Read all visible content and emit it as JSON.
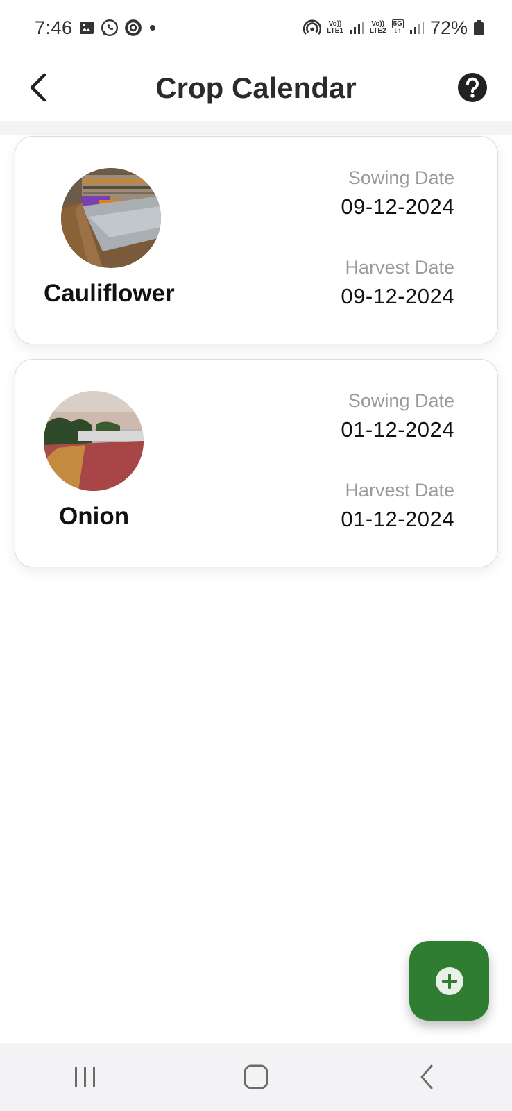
{
  "status_bar": {
    "time": "7:46",
    "battery": "72%",
    "sim1": "LTE1",
    "sim2": "LTE2",
    "network": "5G",
    "icons": [
      "gallery-icon",
      "whatsapp-icon",
      "chat-icon",
      "dot-icon",
      "hotspot-icon",
      "signal-icon",
      "battery-icon"
    ]
  },
  "app_bar": {
    "title": "Crop Calendar",
    "back_icon": "chevron-left-icon",
    "help_icon": "help-circle-icon"
  },
  "crops": [
    {
      "name": "Cauliflower",
      "sowing_label": "Sowing Date",
      "sowing_date": "09-12-2024",
      "harvest_label": "Harvest Date",
      "harvest_date": "09-12-2024"
    },
    {
      "name": "Onion",
      "sowing_label": "Sowing Date",
      "sowing_date": "01-12-2024",
      "harvest_label": "Harvest Date",
      "harvest_date": "01-12-2024"
    }
  ],
  "fab": {
    "icon": "plus-circle-icon"
  },
  "colors": {
    "accent": "#2e7d32",
    "label_gray": "#9a9a9a"
  },
  "nav_bar": {
    "icons": [
      "recent-apps-icon",
      "home-icon",
      "back-icon"
    ]
  }
}
